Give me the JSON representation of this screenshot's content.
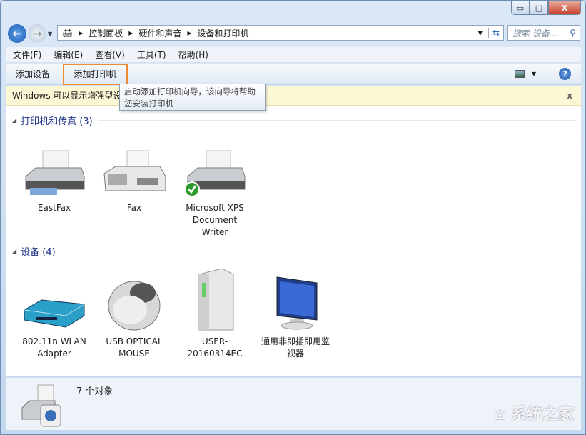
{
  "window": {
    "minimize": "▭",
    "maximize": "□",
    "close": "X"
  },
  "address": {
    "crumbs": [
      "控制面板",
      "硬件和声音",
      "设备和打印机"
    ],
    "search_placeholder": "搜索 设备..."
  },
  "menu": [
    "文件(F)",
    "编辑(E)",
    "查看(V)",
    "工具(T)",
    "帮助(H)"
  ],
  "toolbar": {
    "add_device": "添加设备",
    "add_printer": "添加打印机",
    "help": "?"
  },
  "infobar": {
    "text": "Windows 可以显示增强型设备图标和信息。单击进行更改...",
    "close": "x"
  },
  "tooltip": {
    "text": "启动添加打印机向导，该向导将帮助您安装打印机"
  },
  "groups": [
    {
      "title": "打印机和传真 (3)",
      "items": [
        "EastFax",
        "Fax",
        "Microsoft XPS Document Writer"
      ]
    },
    {
      "title": "设备 (4)",
      "items": [
        "802.11n WLAN Adapter",
        "USB OPTICAL MOUSE",
        "USER-20160314EC",
        "通用非即插即用监视器"
      ]
    }
  ],
  "status": {
    "count": "7 个对象"
  },
  "watermark": "系统之家",
  "colors": {
    "highlight": "#ef8a2f",
    "infobar": "#fcf8d6",
    "group_title": "#1e3287"
  }
}
